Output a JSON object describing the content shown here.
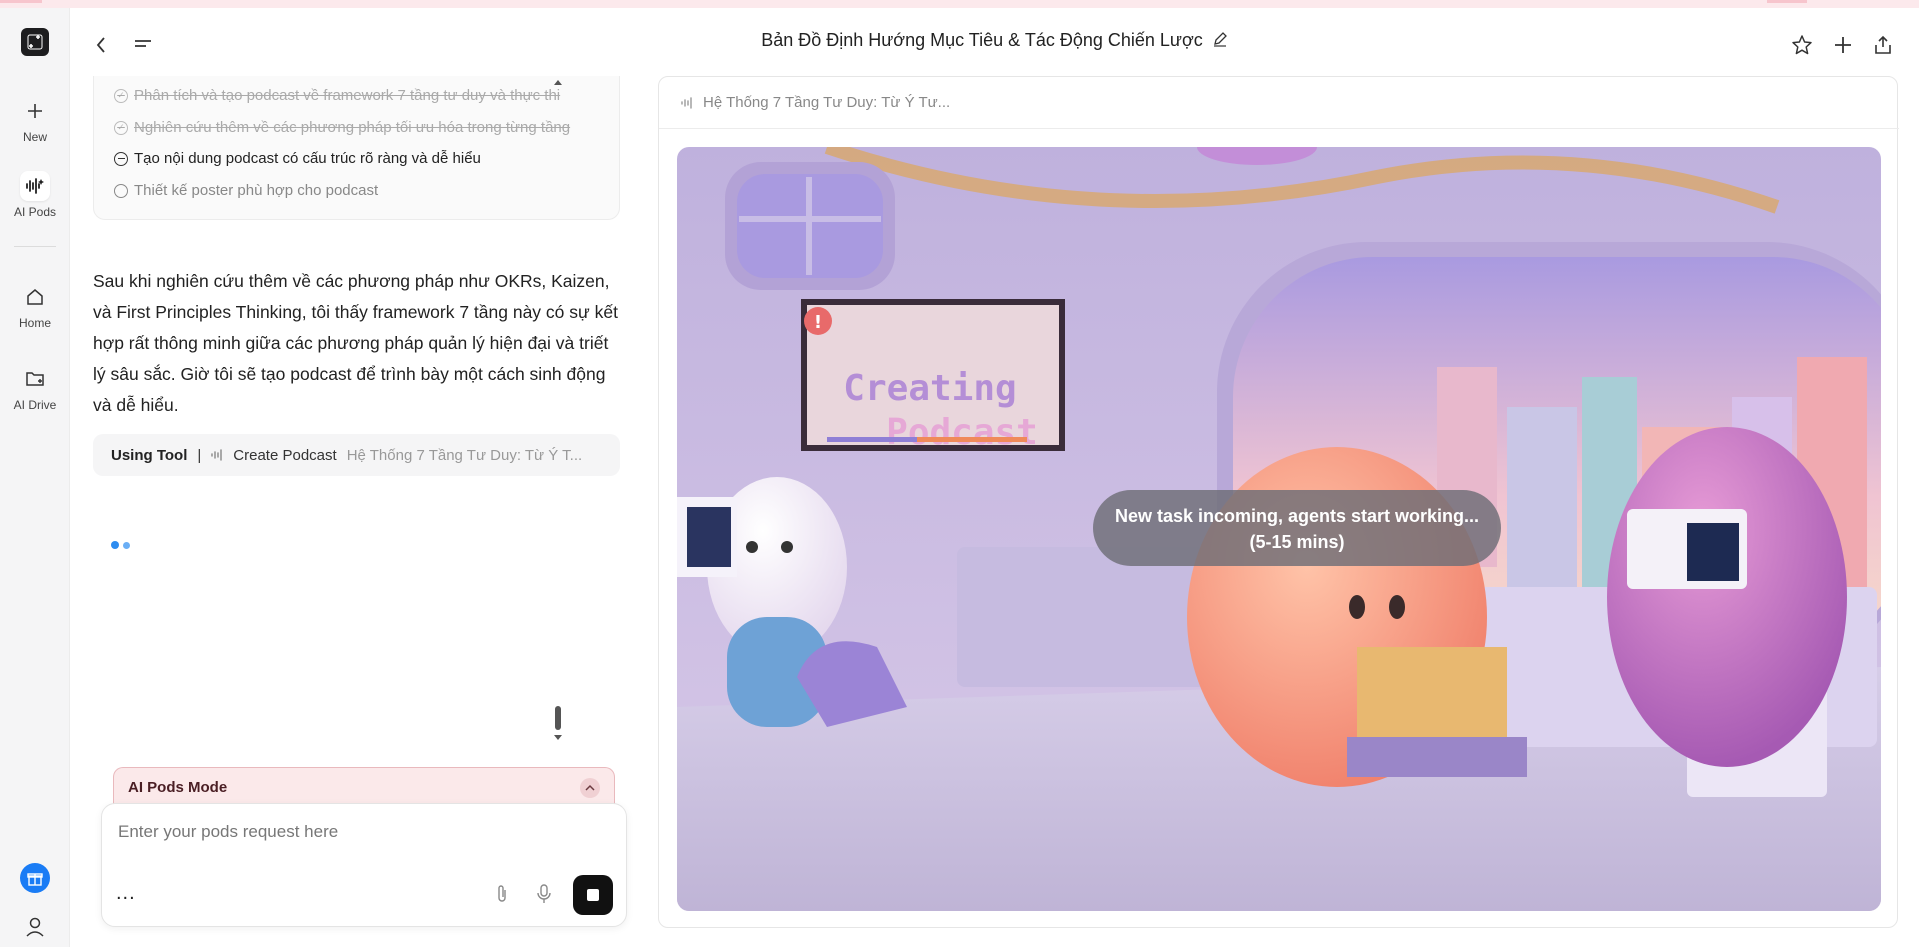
{
  "header": {
    "title": "Bản Đồ Định Hướng Mục Tiêu & Tác Động Chiến Lược"
  },
  "rail": {
    "items": [
      {
        "label": "New",
        "icon": "plus-icon"
      },
      {
        "label": "AI Pods",
        "icon": "audio-wave-icon"
      },
      {
        "label": "Home",
        "icon": "home-icon"
      },
      {
        "label": "AI Drive",
        "icon": "folder-icon"
      }
    ]
  },
  "plan": {
    "items": [
      {
        "text": "Phân tích và tạo podcast về framework 7 tầng tư duy và thực thi",
        "status": "done"
      },
      {
        "text": "Nghiên cứu thêm về các phương pháp tối ưu hóa trong từng tầng",
        "status": "done"
      },
      {
        "text": "Tạo nội dung podcast có cấu trúc rõ ràng và dễ hiểu",
        "status": "in-progress"
      },
      {
        "text": "Thiết kế poster phù hợp cho podcast",
        "status": "todo"
      }
    ]
  },
  "message": {
    "text": "Sau khi nghiên cứu thêm về các phương pháp như OKRs, Kaizen, và First Principles Thinking, tôi thấy framework 7 tầng này có sự kết hợp rất thông minh giữa các phương pháp quản lý hiện đại và triết lý sâu sắc. Giờ tôi sẽ tạo podcast để trình bày một cách sinh động và dễ hiểu."
  },
  "tool": {
    "label": "Using Tool",
    "separator": "|",
    "name": "Create Podcast",
    "argument": "Hệ Thống 7 Tầng Tư Duy: Từ Ý T..."
  },
  "composer": {
    "mode_label": "AI Pods Mode",
    "placeholder": "Enter your pods request here",
    "more": "..."
  },
  "panel": {
    "title": "Hệ Thống 7 Tầng Tư Duy: Từ Ý Tư...",
    "sign_text_line1": "Creating",
    "sign_text_line2": "Podcast",
    "status_line1": "New task incoming, agents start working...",
    "status_line2": "(5-15 mins)"
  },
  "colors": {
    "accent": "#2d8cf0",
    "mode_bg": "#fbe9ea",
    "mode_text": "#4a1e24"
  }
}
